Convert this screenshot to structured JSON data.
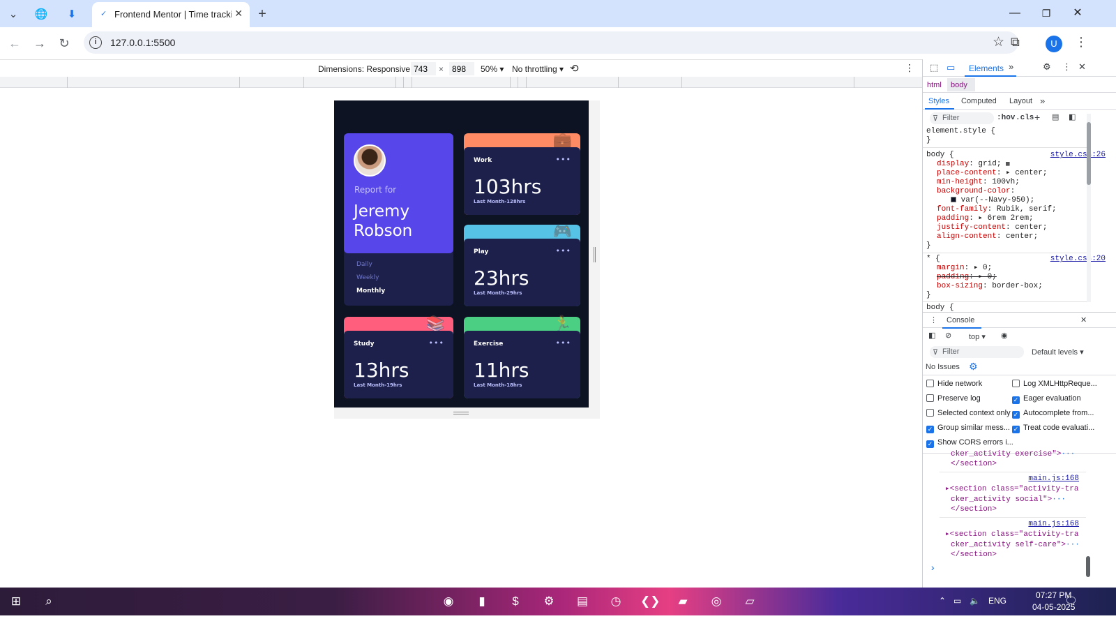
{
  "browser": {
    "tab_title": "Frontend Mentor | Time tracking",
    "url": "127.0.0.1:5500",
    "profile_initial": "U"
  },
  "device_toolbar": {
    "dimensions_label": "Dimensions: Responsive",
    "width": "743",
    "height": "898",
    "x_sep": "×",
    "zoom": "50%",
    "throttling": "No throttling"
  },
  "app": {
    "report_for": "Report for",
    "user_name": "Jeremy Robson",
    "timeframes": [
      "Daily",
      "Weekly",
      "Monthly"
    ],
    "selected_timeframe": "Monthly",
    "activities": [
      {
        "label": "Work",
        "hours": "103hrs",
        "previous": "Last Month-128hrs",
        "color": "#ff8b64"
      },
      {
        "label": "Play",
        "hours": "23hrs",
        "previous": "Last Month-29hrs",
        "color": "#55c2e6"
      },
      {
        "label": "Study",
        "hours": "13hrs",
        "previous": "Last Month-19hrs",
        "color": "#ff5e7d"
      },
      {
        "label": "Exercise",
        "hours": "11hrs",
        "previous": "Last Month-18hrs",
        "color": "#4bcf82"
      }
    ],
    "menu_glyph": "•••"
  },
  "devtools": {
    "tabs": {
      "elements": "Elements"
    },
    "breadcrumb": [
      "html",
      "body"
    ],
    "style_tabs": [
      "Styles",
      "Computed",
      "Layout"
    ],
    "filter_placeholder": "Filter",
    "hov": ":hov",
    "cls": ".cls",
    "styles_code": {
      "element_style": "element.style {",
      "close": "}",
      "body_selector": "body {",
      "body_src": "style.css:26",
      "star_selector": "* {",
      "star_src": "style.css:20",
      "body_ua": "body {",
      "body_props": [
        {
          "p": "display",
          "v": "grid;"
        },
        {
          "p": "place-content",
          "v": "▸ center;"
        },
        {
          "p": "min-height",
          "v": "100vh;"
        },
        {
          "p": "background-color",
          "v": ""
        },
        {
          "p": "",
          "v": "var(--Navy-950);"
        },
        {
          "p": "font-family",
          "v": "Rubik, serif;"
        },
        {
          "p": "padding",
          "v": "▸ 6rem 2rem;"
        },
        {
          "p": "justify-content",
          "v": "center;"
        },
        {
          "p": "align-content",
          "v": "center;"
        }
      ],
      "star_props": [
        {
          "p": "margin",
          "v": "▸ 0;"
        },
        {
          "p": "padding",
          "v": "▸ 0;"
        },
        {
          "p": "box-sizing",
          "v": "border-box;"
        }
      ]
    },
    "console": {
      "title": "Console",
      "context": "top",
      "filter_placeholder": "Filter",
      "levels": "Default levels",
      "issues": "No Issues",
      "options_left": [
        {
          "label": "Hide network",
          "checked": false
        },
        {
          "label": "Preserve log",
          "checked": false
        },
        {
          "label": "Selected context only",
          "checked": false
        },
        {
          "label": "Group similar mess...",
          "checked": true
        },
        {
          "label": "Show CORS errors i...",
          "checked": true
        }
      ],
      "options_right": [
        {
          "label": "Log XMLHttpReque...",
          "checked": false
        },
        {
          "label": "Eager evaluation",
          "checked": true
        },
        {
          "label": "Autocomplete from...",
          "checked": true
        },
        {
          "label": "Treat code evaluati...",
          "checked": true
        }
      ],
      "log_lines": [
        {
          "text": "cker_activity exercise\">",
          "ellipsis": "···"
        },
        {
          "text": "</section>"
        },
        {
          "src": "main.js:168"
        },
        {
          "text": "<section class=\"activity-tra"
        },
        {
          "text": "cker_activity social\">",
          "ellipsis": "···"
        },
        {
          "text": "</section>"
        },
        {
          "src": "main.js:168"
        },
        {
          "text": "<section class=\"activity-tra"
        },
        {
          "text": "cker_activity self-care\">",
          "ellipsis": "···"
        },
        {
          "text": "</section>"
        }
      ],
      "prompt": "›"
    }
  },
  "taskbar": {
    "lang": "ENG",
    "time": "07:27 PM",
    "date": "04-05-2025"
  }
}
